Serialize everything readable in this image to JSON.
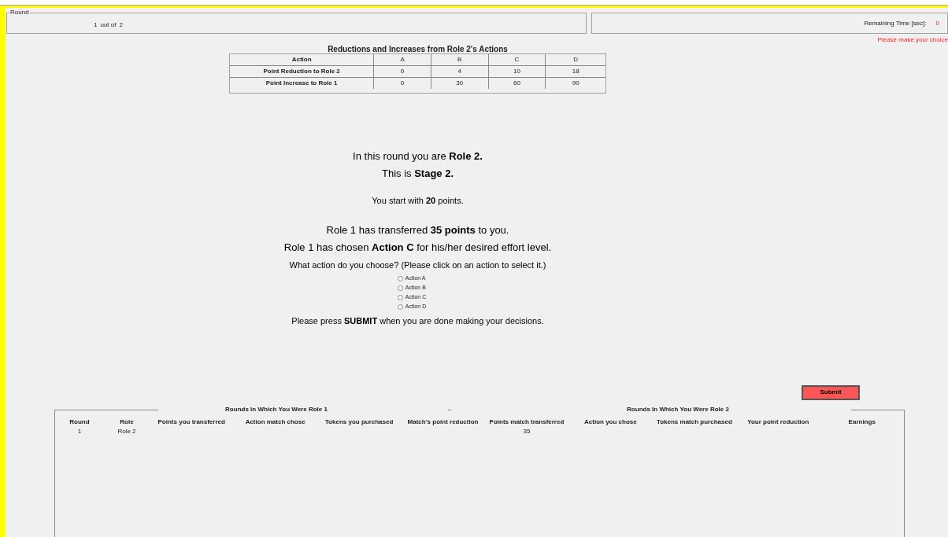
{
  "round_box": {
    "legend": "Round",
    "current": "1",
    "separator": "out of",
    "total": "2"
  },
  "timer": {
    "label": "Remaining Time [sec]:",
    "value": "0",
    "warning": "Please make your choice"
  },
  "payoff_table": {
    "title": "Reductions and Increases from Role 2's Actions",
    "columns": [
      "Action",
      "A",
      "B",
      "C",
      "D"
    ],
    "rows": [
      [
        "Point Reduction to Role 2",
        "0",
        "4",
        "10",
        "18"
      ],
      [
        "Point Increase to Role 1",
        "0",
        "30",
        "60",
        "90"
      ]
    ]
  },
  "messages": [
    "In this round you are **Role 2.**",
    "This is **Stage 2.**",
    "You start with **20** points.",
    "Role 1 has transferred **35 points** to you.",
    "Role 1 has chosen **Action C** for his/her desired effort level.",
    "What action do you choose? (Please click on an action to select it.)"
  ],
  "actions": [
    {
      "label": "Action A",
      "selected": false
    },
    {
      "label": "Action B",
      "selected": false
    },
    {
      "label": "Action C",
      "selected": false
    },
    {
      "label": "Action D",
      "selected": false
    }
  ],
  "submit_note": "Please press **SUBMIT** when you are done making your decisions.",
  "submit_button": "Submit",
  "history": {
    "group_1": "Rounds In Which You Were Role 1",
    "divider": "–",
    "group_2": "Rounds In Which You Were Role 2",
    "columns": [
      {
        "header": "Round",
        "value": "1"
      },
      {
        "header": "Role",
        "value": "Role 2"
      },
      {
        "header": "Points you transferred"
      },
      {
        "header": "Action match chose"
      },
      {
        "header": "Tokens you purchased"
      },
      {
        "header": "Match's point reduction"
      },
      {
        "header": "Points match transferred",
        "value": "35"
      },
      {
        "header": "Action you chose"
      },
      {
        "header": "Tokens match purchased"
      },
      {
        "header": "Your point reduction"
      },
      {
        "header": "Earnings"
      }
    ]
  }
}
